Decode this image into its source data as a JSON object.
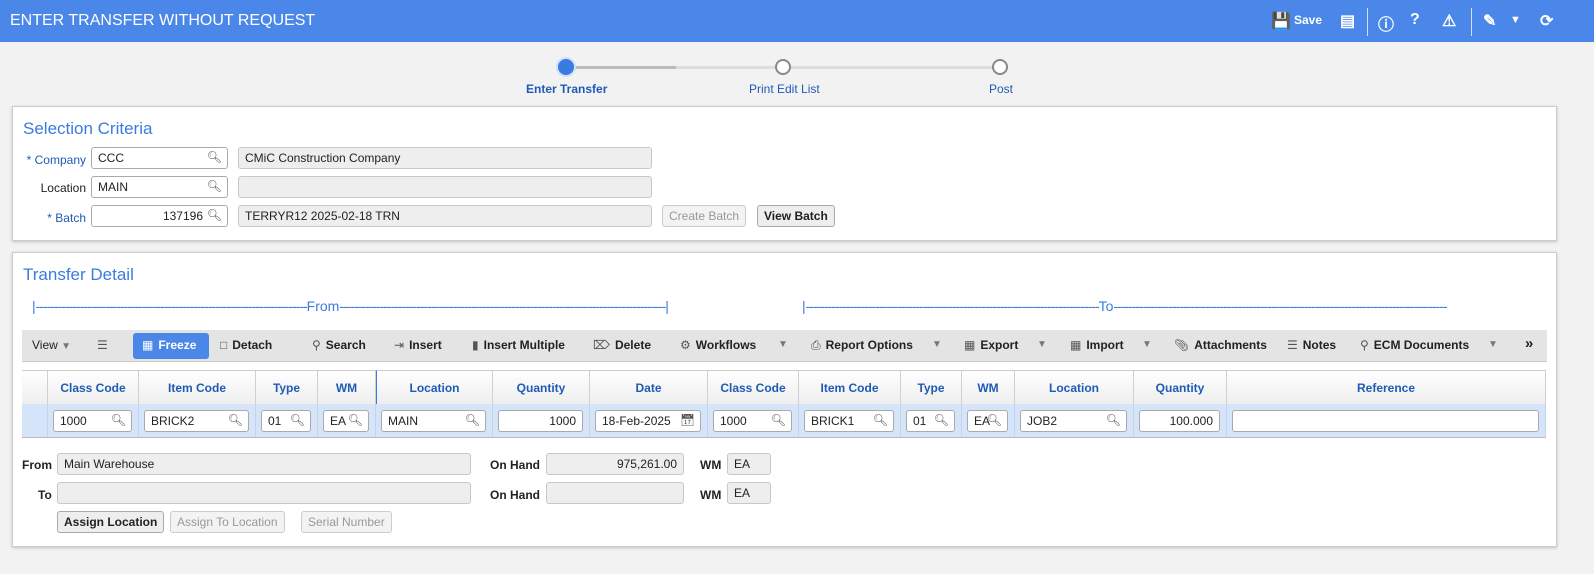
{
  "header": {
    "title": "ENTER TRANSFER WITHOUT REQUEST",
    "save_label": "Save"
  },
  "stepper": {
    "steps": [
      "Enter Transfer",
      "Print Edit List",
      "Post"
    ],
    "current": 0
  },
  "selection": {
    "title": "Selection Criteria",
    "company_label": "* Company",
    "company": "CCC",
    "company_name": "CMiC Construction Company",
    "location_label": "Location",
    "location": "MAIN",
    "location_name": "",
    "batch_label": "* Batch",
    "batch": "137196",
    "batch_desc": "TERRYR12 2025-02-18 TRN",
    "create_batch": "Create Batch",
    "view_batch": "View Batch"
  },
  "detail": {
    "title": "Transfer Detail",
    "from_label": "From",
    "to_label": "To",
    "toolbar": {
      "view": "View",
      "freeze": "Freeze",
      "detach": "Detach",
      "search": "Search",
      "insert": "Insert",
      "insert_multiple": "Insert Multiple",
      "delete": "Delete",
      "workflows": "Workflows",
      "report_options": "Report Options",
      "export": "Export",
      "import": "Import",
      "attachments": "Attachments",
      "notes": "Notes",
      "ecm": "ECM Documents",
      "more": "»"
    },
    "columns": [
      "Class Code",
      "Item Code",
      "Type",
      "WM",
      "Location",
      "Quantity",
      "Date",
      "Class Code",
      "Item Code",
      "Type",
      "WM",
      "Location",
      "Quantity",
      "Reference"
    ],
    "row": [
      "1000",
      "BRICK2",
      "01",
      "EA",
      "MAIN",
      "1000",
      "18-Feb-2025",
      "1000",
      "BRICK1",
      "01",
      "EA",
      "JOB2",
      "100.000",
      ""
    ],
    "footer": {
      "from_label": "From",
      "from_value": "Main Warehouse",
      "to_label": "To",
      "to_value": "",
      "onhand_label": "On Hand",
      "onhand_from": "975,261.00",
      "onhand_to": "",
      "wm_label": "WM",
      "wm_from": "EA",
      "wm_to": "EA",
      "assign_location": "Assign Location",
      "assign_to_location": "Assign To Location",
      "serial_number": "Serial Number"
    }
  }
}
